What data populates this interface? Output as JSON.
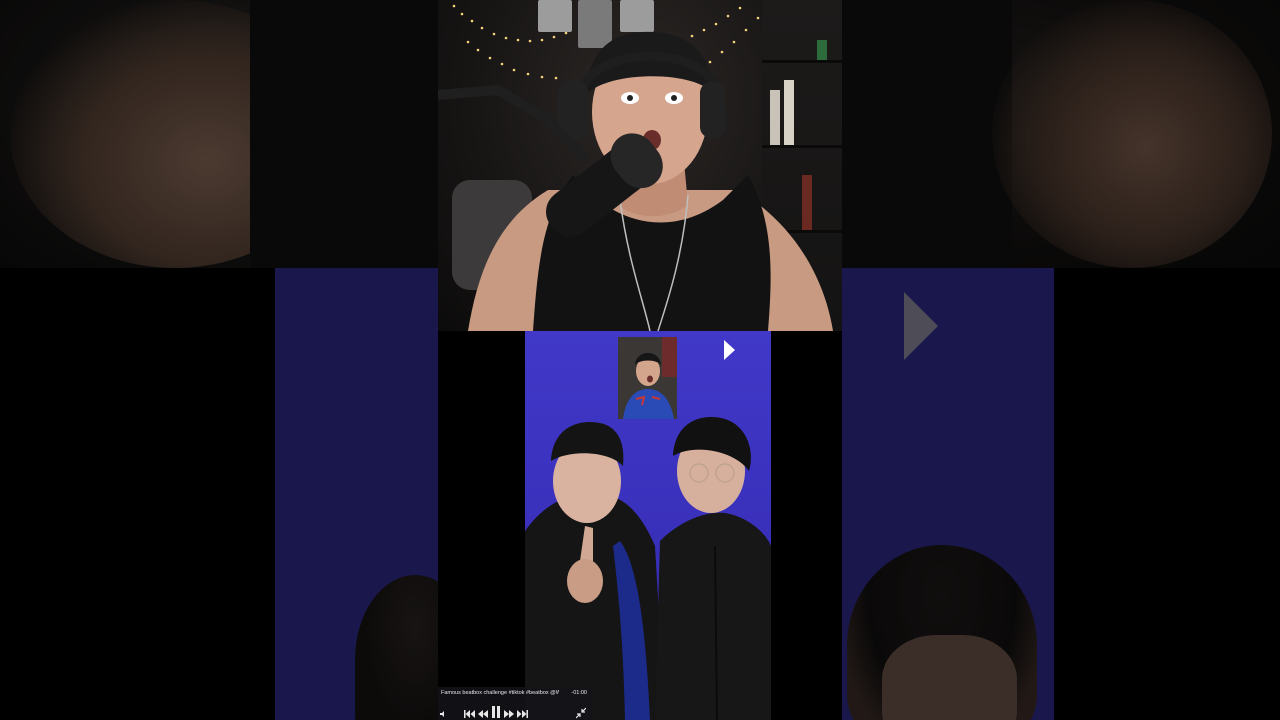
{
  "mini_player": {
    "title": "Famous beatbox challenge #tiktok #beatbox @WIN...",
    "time": "-01:00"
  },
  "icons": {
    "play": "play-icon",
    "skip_back": "skip-back-icon",
    "rewind": "rewind-icon",
    "pause": "pause-icon",
    "fast_forward": "fast-forward-icon",
    "skip_forward": "skip-forward-icon",
    "exit_fullscreen": "exit-fullscreen-icon"
  },
  "colors": {
    "tiktok_background": "#3a31bd",
    "player_bar": "#141418"
  }
}
